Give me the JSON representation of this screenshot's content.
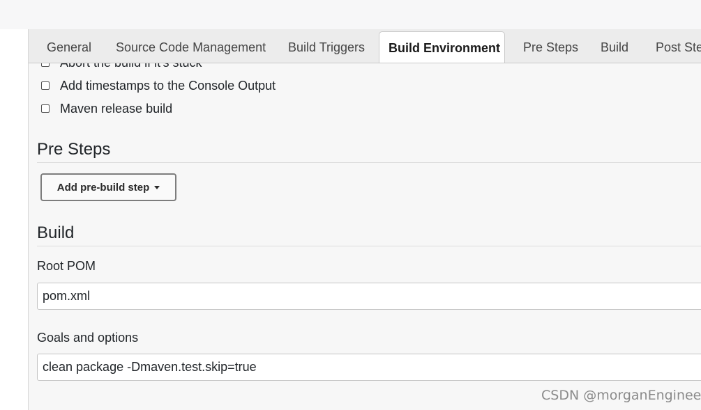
{
  "tabs": [
    {
      "label": "General"
    },
    {
      "label": "Source Code Management"
    },
    {
      "label": "Build Triggers"
    },
    {
      "label": "Build Environment",
      "active": true
    },
    {
      "label": "Pre Steps"
    },
    {
      "label": "Build"
    },
    {
      "label": "Post Steps"
    }
  ],
  "build_environment": {
    "checkboxes": [
      {
        "label": "Abort the build if it's stuck",
        "checked": false
      },
      {
        "label": "Add timestamps to the Console Output",
        "checked": false
      },
      {
        "label": "Maven release build",
        "checked": false
      }
    ]
  },
  "pre_steps": {
    "title": "Pre Steps",
    "add_button_label": "Add pre-build step"
  },
  "build": {
    "title": "Build",
    "root_pom_label": "Root POM",
    "root_pom_value": "pom.xml",
    "goals_label": "Goals and options",
    "goals_value": "clean package -Dmaven.test.skip=true"
  },
  "watermark": "CSDN @morganEngineer"
}
